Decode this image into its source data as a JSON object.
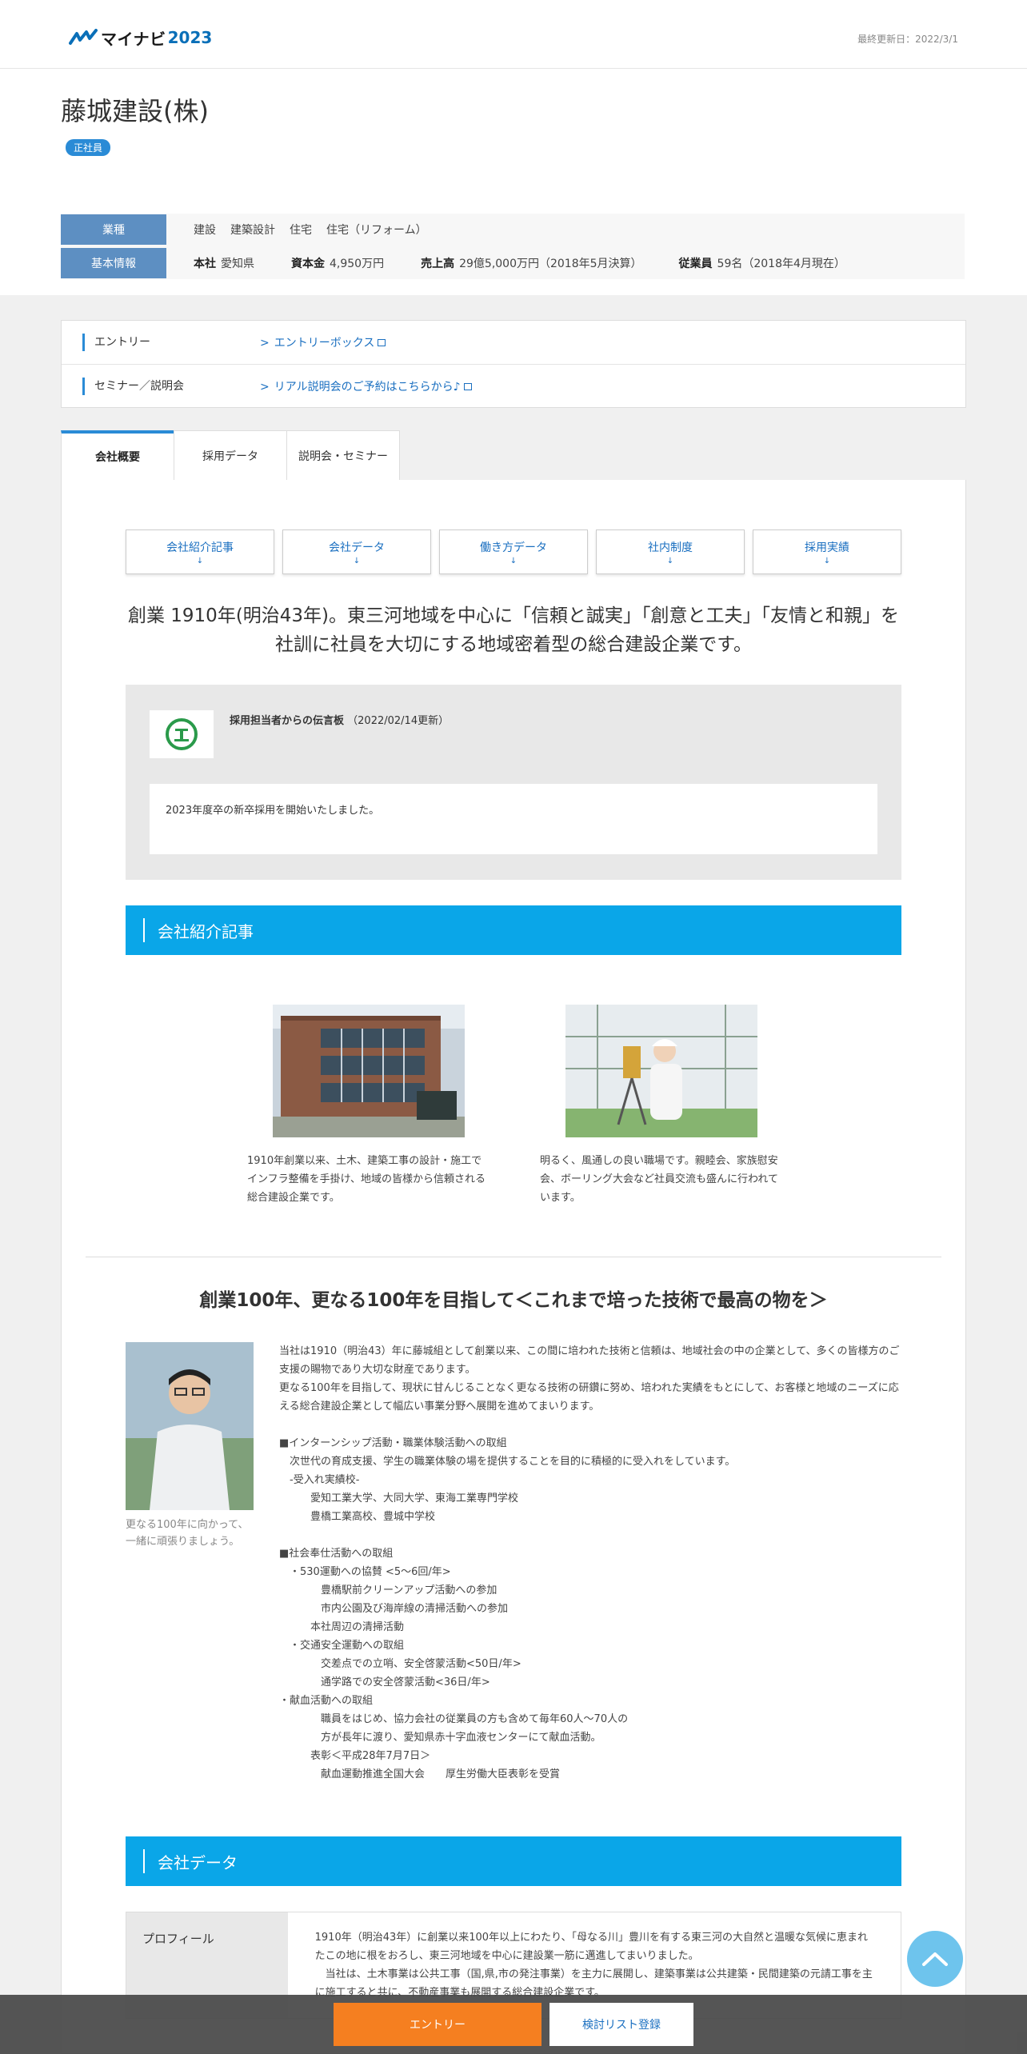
{
  "header": {
    "logo_text": "マイナビ",
    "logo_year": "2023",
    "updated": "最終更新日：2022/3/1"
  },
  "company": {
    "name": "藤城建設(株)",
    "badge": "正社員",
    "info": {
      "industry_label": "業種",
      "industry_values": [
        "建設",
        "建築設計",
        "住宅",
        "住宅（リフォーム）"
      ],
      "basic_label": "基本情報",
      "hq_label": "本社",
      "hq_value": "愛知県",
      "capital_label": "資本金",
      "capital_value": "4,950万円",
      "sales_label": "売上高",
      "sales_value": "29億5,000万円（2018年5月決算）",
      "staff_label": "従業員",
      "staff_value": "59名（2018年4月現在）"
    }
  },
  "entry": {
    "rows": [
      {
        "label": "エントリー",
        "link": "エントリーボックス"
      },
      {
        "label": "セミナー／説明会",
        "link": "リアル説明会のご予約はこちらから♪"
      }
    ]
  },
  "tabs": [
    "会社概要",
    "採用データ",
    "説明会・セミナー"
  ],
  "anchors": [
    "会社紹介記事",
    "会社データ",
    "働き方データ",
    "社内制度",
    "採用実績"
  ],
  "anchor_arrow": "↓",
  "catch": "創業 1910年(明治43年)。東三河地域を中心に「信頼と誠実」「創意と工夫」「友情と和親」を社訓に社員を大切にする地域密着型の総合建設企業です。",
  "message": {
    "title": "採用担当者からの伝言板",
    "date": "（2022/02/14更新）",
    "body": "2023年度卒の新卒採用を開始いたしました。"
  },
  "section1_title": "会社紹介記事",
  "articles": [
    {
      "text": "1910年創業以来、土木、建築工事の設計・施工でインフラ整備を手掛け、地域の皆様から信頼される総合建設企業です。"
    },
    {
      "text": "明るく、風通しの良い職場です。親睦会、家族慰安会、ボーリング大会など社員交流も盛んに行われています。"
    }
  ],
  "sub_catch": "創業100年、更なる100年を目指して＜これまで培った技術で最高の物を＞",
  "intro_caption": "更なる100年に向かって、一緒に頑張りましょう。",
  "intro_text": "当社は1910（明治43）年に藤城組として創業以来、この間に培われた技術と信頼は、地域社会の中の企業として、多くの皆様方のご支援の賜物であり大切な財産であります。\n更なる100年を目指して、現状に甘んじることなく更なる技術の研鑽に努め、培われた実績をもとにして、お客様と地域のニーズに応える総合建設企業として幅広い事業分野へ展開を進めてまいります。\n\n■インターンシップ活動・職業体験活動への取組\n　次世代の育成支援、学生の職業体験の場を提供することを目的に積極的に受入れをしています。\n　-受入れ実績校-\n　　　愛知工業大学、大同大学、東海工業専門学校\n　　　豊橋工業高校、豊城中学校\n\n■社会奉仕活動への取組\n　・530運動への協賛 <5～6回/年>\n　　　　豊橋駅前クリーンアップ活動への参加\n　　　　市内公園及び海岸線の清掃活動への参加\n　　　本社周辺の清掃活動\n　・交通安全運動への取組\n　　　　交差点での立哨、安全啓蒙活動<50日/年>\n　　　　通学路での安全啓蒙活動<36日/年>\n・献血活動への取組\n　　　　職員をはじめ、協力会社の従業員の方も含めて毎年60人～70人の\n　　　　方が長年に渡り、愛知県赤十字血液センターにて献血活動。\n　　　表彰＜平成28年7月7日＞\n　　　　献血運動推進全国大会　　厚生労働大臣表彰を受賞",
  "section2_title": "会社データ",
  "profile": {
    "label": "プロフィール",
    "text": "1910年（明治43年）に創業以来100年以上にわたり、「母なる川」豊川を有する東三河の大自然と温暖な気候に恵まれたこの地に根をおろし、東三河地域を中心に建設業一筋に邁進してまいりました。\n　当社は、土木事業は公共工事（国,県,市の発注事業）を主力に展開し、建築事業は公共建築・民間建築の元請工事を主に施工すると共に、不動産事業も展開する総合建設企業です。"
  },
  "bottom": {
    "entry": "エントリー",
    "list": "検討リスト登録"
  },
  "colors": {
    "accent": "#0aa6e8",
    "link": "#1a6fc0",
    "entry_button": "#f57f20",
    "info_key": "#5d8fc2"
  }
}
